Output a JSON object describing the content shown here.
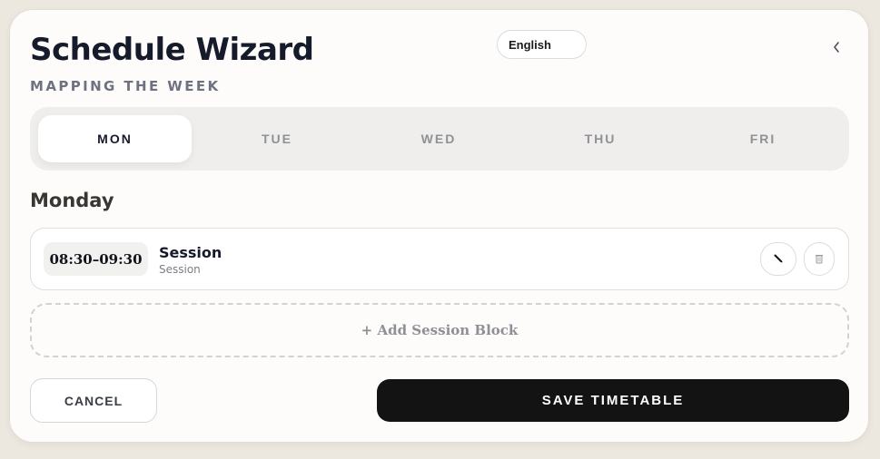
{
  "header": {
    "title": "Schedule Wizard",
    "subtitle": "MAPPING THE WEEK",
    "language": "English",
    "back_icon": "chevron-left-icon"
  },
  "tabs": [
    {
      "label": "MON",
      "active": true
    },
    {
      "label": "TUE",
      "active": false
    },
    {
      "label": "WED",
      "active": false
    },
    {
      "label": "THU",
      "active": false
    },
    {
      "label": "FRI",
      "active": false
    }
  ],
  "day": {
    "heading": "Monday",
    "sessions": [
      {
        "time": "08:30–09:30",
        "title": "Session",
        "subtitle": "Session",
        "edit_icon": "pencil-icon",
        "delete_icon": "trash-icon"
      }
    ],
    "add_label": "+ Add Session Block"
  },
  "footer": {
    "cancel_label": "CANCEL",
    "save_label": "SAVE TIMETABLE"
  },
  "colors": {
    "background": "#ece8df",
    "card": "#fdfcfa",
    "primary_dark": "#131313",
    "title": "#161b2c",
    "muted": "#8e9196"
  }
}
